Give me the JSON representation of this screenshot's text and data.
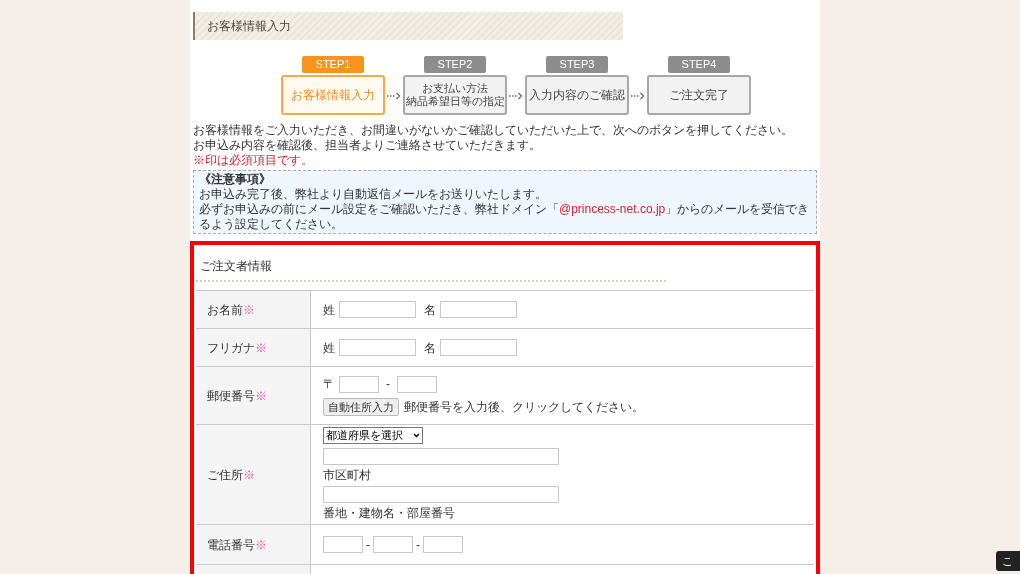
{
  "page_title": "お客様情報入力",
  "steps": [
    {
      "label": "STEP1",
      "text": "お客様情報入力",
      "selected": true
    },
    {
      "label": "STEP2",
      "text": [
        "お支払い方法",
        "納品希望日等の指定"
      ],
      "selected": false
    },
    {
      "label": "STEP3",
      "text": "入力内容のご確認",
      "selected": false
    },
    {
      "label": "STEP4",
      "text": "ご注文完了",
      "selected": false
    }
  ],
  "intro": [
    "お客様情報をご入力いただき、お間違いがないかご確認していただいた上で、次へのボタンを押してください。",
    "お申込み内容を確認後、担当者よりご連絡させていただきます。"
  ],
  "required_note": "※印は必須項目です。",
  "notice": {
    "title": "《注意事項》",
    "line_1": "お申込み完了後、弊社より自動返信メールをお送りいたします。",
    "line_2_before": "必ずお申込みの前にメール設定をご確認いただき、弊社ドメイン「",
    "domain_link": "@princess-net.co.jp",
    "line_2_after": "」からのメールを受信できるよう設定してください。"
  },
  "section_title": "ご注文者情報",
  "rows": [
    {
      "kind": "name",
      "label": "お名前",
      "mark": "※",
      "sei": "姓",
      "mei": "名"
    },
    {
      "kind": "name",
      "label": "フリガナ",
      "mark": "※",
      "sei": "姓",
      "mei": "名"
    },
    {
      "kind": "postal",
      "label": "郵便番号",
      "mark": "※",
      "prefix": "〒",
      "dash": "-",
      "button": "自動住所入力",
      "hint": "郵便番号を入力後、クリックしてください。"
    },
    {
      "kind": "address",
      "label": "ご住所",
      "mark": "※",
      "select": "都道府県を選択",
      "caption_1": "市区町村",
      "caption_2": "番地・建物名・部屋番号"
    },
    {
      "kind": "phone",
      "label": "電話番号",
      "mark": "※",
      "dash": "-"
    },
    {
      "kind": "blank"
    }
  ],
  "corner_button": "こ"
}
